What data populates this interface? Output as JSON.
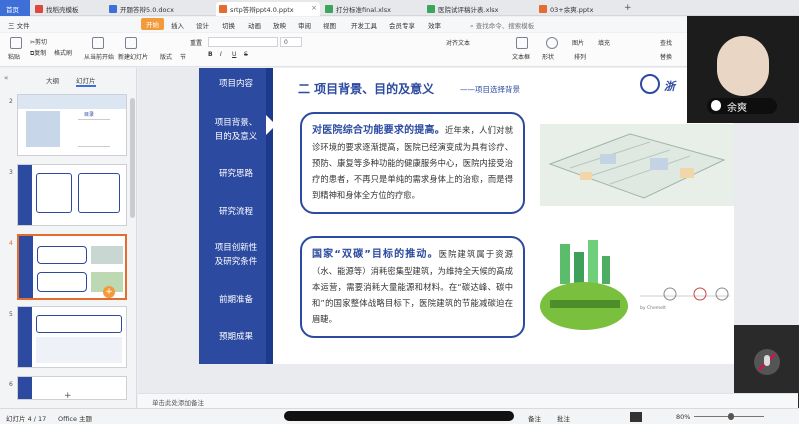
{
  "tabs": [
    {
      "label": "首页",
      "color": "#3d6fd6"
    },
    {
      "label": "找稻壳模板",
      "color": "#e0473b"
    },
    {
      "label": "开题答辩5.0.docx",
      "color": "#3d6fd6"
    },
    {
      "label": "srtp答辩ppt4.0.pptx",
      "color": "#e36c2f"
    },
    {
      "label": "打分标准final.xlsx",
      "color": "#3aa55b"
    },
    {
      "label": "医院试评稿计表.xlsx",
      "color": "#3aa55b"
    },
    {
      "label": "03+余爽.pptx",
      "color": "#e36c2f"
    }
  ],
  "menus": [
    "三 文件",
    "开始",
    "插入",
    "设计",
    "切换",
    "动画",
    "放映",
    "审阅",
    "视图",
    "开发工具",
    "会员专享",
    "效率",
    "查找命令、搜索模板"
  ],
  "toolbar": {
    "paste": "粘贴",
    "cut": "剪切",
    "copy": "复制",
    "format_painter": "格式刷",
    "from_current": "从当前开始",
    "new_slide": "新建幻灯片",
    "layout": "版式",
    "section": "节",
    "reset": "重置",
    "font_size": "0",
    "bold": "B",
    "italic": "I",
    "underline": "U",
    "strike": "S",
    "align_text": "对齐文本",
    "textbox": "文本框",
    "shape": "形状",
    "arrange": "排列",
    "image": "图片",
    "fill": "填充",
    "find": "查找",
    "replace": "替换"
  },
  "panel": {
    "outline_tab": "大纲",
    "slides_tab": "幻灯片",
    "slide_numbers": [
      "2",
      "3",
      "4",
      "5",
      "6"
    ],
    "thumb2_title": "目录"
  },
  "slide": {
    "header_title": "二  项目背景、目的及意义",
    "header_sub": "——项目选择背景",
    "logo_text": "浙",
    "nav": [
      "项目内容",
      "项目背景、\n目的及意义",
      "研究思路",
      "研究流程",
      "项目创新性\n及研究条件",
      "前期准备",
      "预期成果"
    ],
    "card1_title": "对医院综合功能要求的提高。",
    "card1_body": "近年来，人们对就诊环境的要求逐渐提高，医院已经演变成为具有诊疗、预防、康复等多种功能的健康服务中心，医院内接受治疗的患者，不再只是单纯的需求身体上的治愈，而是得到精神和身体全方位的疗愈。",
    "card2_title": "国家“双碳”目标的推动。",
    "card2_body": "医院建筑属于资源（水、能源等）消耗密集型建筑，为维持全天候的高成本运营，需要消耗大量能源和材料。在“碳达峰、碳中和”的国家整体战略目标下，医院建筑的节能减碳迫在眉睫。",
    "diagram_caption": "by Chemelt"
  },
  "notes_placeholder": "单击此处添加备注",
  "status": {
    "slide_info": "幻灯片 4 / 17",
    "theme": "Office 主题",
    "notes": "备注",
    "comments": "批注",
    "zoom": "80%"
  },
  "video": {
    "name": "余爽"
  }
}
